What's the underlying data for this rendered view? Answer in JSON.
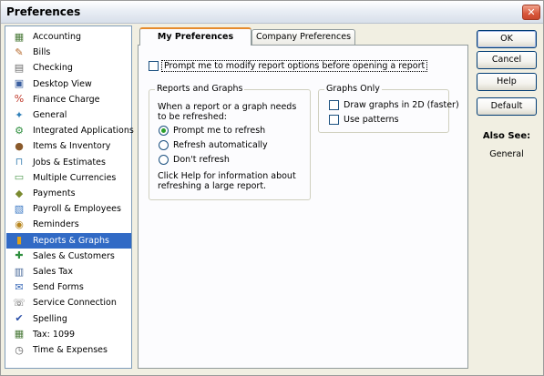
{
  "window": {
    "title": "Preferences",
    "close_glyph": "✕"
  },
  "sidebar": {
    "items": [
      {
        "label": "Accounting",
        "icon": "accounting-icon",
        "glyph": "▦",
        "color": "#4a7a3a"
      },
      {
        "label": "Bills",
        "icon": "bills-icon",
        "glyph": "✎",
        "color": "#b5672a"
      },
      {
        "label": "Checking",
        "icon": "checking-icon",
        "glyph": "▤",
        "color": "#6b6b6b"
      },
      {
        "label": "Desktop View",
        "icon": "desktop-view-icon",
        "glyph": "▣",
        "color": "#3a5fa0"
      },
      {
        "label": "Finance Charge",
        "icon": "finance-charge-icon",
        "glyph": "%",
        "color": "#c0392b"
      },
      {
        "label": "General",
        "icon": "general-icon",
        "glyph": "✦",
        "color": "#2f7fb8"
      },
      {
        "label": "Integrated Applications",
        "icon": "integrated-applications-icon",
        "glyph": "⚙",
        "color": "#2f8f3f"
      },
      {
        "label": "Items & Inventory",
        "icon": "items-inventory-icon",
        "glyph": "●",
        "color": "#8a5a2b"
      },
      {
        "label": "Jobs & Estimates",
        "icon": "jobs-estimates-icon",
        "glyph": "⊓",
        "color": "#4a8ab8"
      },
      {
        "label": "Multiple Currencies",
        "icon": "multiple-currencies-icon",
        "glyph": "▭",
        "color": "#4f9a4f"
      },
      {
        "label": "Payments",
        "icon": "payments-icon",
        "glyph": "◆",
        "color": "#7a8a2f"
      },
      {
        "label": "Payroll & Employees",
        "icon": "payroll-employees-icon",
        "glyph": "▧",
        "color": "#3c79c4"
      },
      {
        "label": "Reminders",
        "icon": "reminders-icon",
        "glyph": "◉",
        "color": "#b8861f"
      },
      {
        "label": "Reports & Graphs",
        "icon": "reports-graphs-icon",
        "glyph": "▮",
        "color": "#e0a21a"
      },
      {
        "label": "Sales & Customers",
        "icon": "sales-customers-icon",
        "glyph": "✚",
        "color": "#2f8f3f"
      },
      {
        "label": "Sales Tax",
        "icon": "sales-tax-icon",
        "glyph": "▥",
        "color": "#4a6a9a"
      },
      {
        "label": "Send Forms",
        "icon": "send-forms-icon",
        "glyph": "✉",
        "color": "#3a6ab8"
      },
      {
        "label": "Service Connection",
        "icon": "service-connection-icon",
        "glyph": "☏",
        "color": "#5a5a5a"
      },
      {
        "label": "Spelling",
        "icon": "spelling-icon",
        "glyph": "✔",
        "color": "#2b4fa8"
      },
      {
        "label": "Tax: 1099",
        "icon": "tax-1099-icon",
        "glyph": "▦",
        "color": "#4a7a3a"
      },
      {
        "label": "Time & Expenses",
        "icon": "time-expenses-icon",
        "glyph": "◷",
        "color": "#5a5a5a"
      }
    ],
    "selected_label": "Reports & Graphs",
    "selection_color": "#316ac5"
  },
  "tabs": {
    "my_preferences": "My Preferences",
    "company_preferences": "Company Preferences",
    "active_accent": "#e68b2c"
  },
  "my_prefs": {
    "prompt_modify_label": "Prompt me to modify report options before opening a report",
    "prompt_modify_checked": false,
    "reports_graphs_title": "Reports and Graphs",
    "refresh_intro": "When a report or a graph needs to be refreshed:",
    "refresh_options": [
      {
        "label": "Prompt me to refresh",
        "checked": true
      },
      {
        "label": "Refresh automatically",
        "checked": false
      },
      {
        "label": "Don't refresh",
        "checked": false
      }
    ],
    "help_note": "Click Help for information about refreshing a large report.",
    "graphs_only_title": "Graphs Only",
    "draw_2d_label": "Draw graphs in 2D (faster)",
    "draw_2d_checked": false,
    "use_patterns_label": "Use patterns",
    "use_patterns_checked": false
  },
  "buttons": {
    "ok": "OK",
    "cancel": "Cancel",
    "help": "Help",
    "default": "Default"
  },
  "also_see": {
    "title": "Also See:",
    "link": "General"
  }
}
